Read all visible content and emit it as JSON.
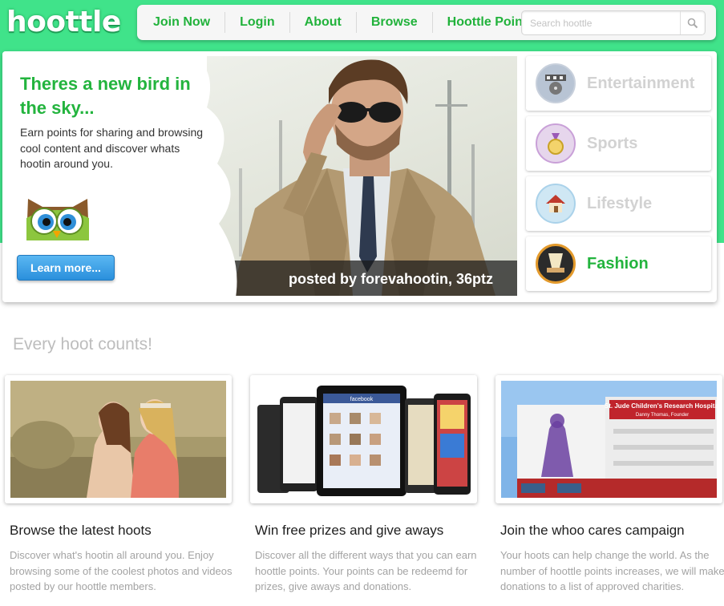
{
  "brand": {
    "logo_text": "hoottle",
    "accent": "#23b43e",
    "band_color": "#40e38a"
  },
  "nav": {
    "items": [
      "Join Now",
      "Login",
      "About",
      "Browse",
      "Hoottle Points"
    ],
    "search_placeholder": "Search hoottle",
    "search_icon": "magnifier-icon"
  },
  "hero": {
    "title": "Theres a new bird in the sky...",
    "text": "Earn points for sharing and browsing cool content and discover whats hootin around you.",
    "button": "Learn more...",
    "caption": "posted by forevahootin, 36ptz"
  },
  "categories": [
    {
      "label": "Entertainment",
      "icon": "film-reel-icon",
      "active": false
    },
    {
      "label": "Sports",
      "icon": "medal-icon",
      "active": false
    },
    {
      "label": "Lifestyle",
      "icon": "house-icon",
      "active": false
    },
    {
      "label": "Fashion",
      "icon": "spotlight-stage-icon",
      "active": true
    }
  ],
  "section": {
    "heading": "Every hoot counts!",
    "features": [
      {
        "title": "Browse the latest hoots",
        "desc": "Discover what's hootin all around you. Enjoy browsing some of the coolest photos and videos posted by our hoottle members."
      },
      {
        "title": "Win free prizes and give aways",
        "desc": "Discover all the different ways that you can earn hoottle points. Your points can be redeemd for prizes, give aways and donations."
      },
      {
        "title": "Join the whoo cares campaign",
        "desc": "Your hoots can help change the world. As the number of hoottle points increases, we will make donations to a list of approved charities."
      }
    ],
    "hospital_sign": "St. Jude Children's Research Hospital",
    "hospital_sub": "Danny Thomas, Founder",
    "tablet_app": "facebook"
  }
}
